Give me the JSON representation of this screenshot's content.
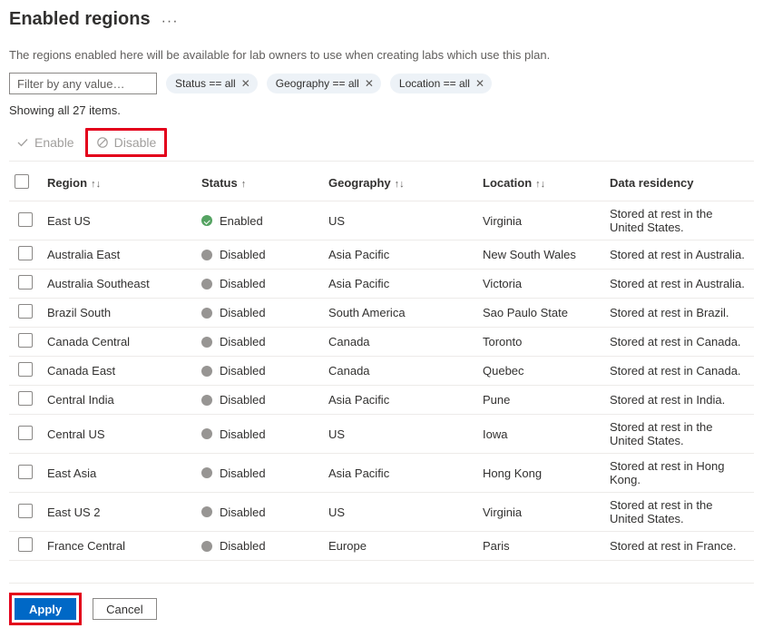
{
  "header": {
    "title": "Enabled regions"
  },
  "description": "The regions enabled here will be available for lab owners to use when creating labs which use this plan.",
  "filter": {
    "placeholder": "Filter by any value…"
  },
  "pills": [
    {
      "label": "Status == all"
    },
    {
      "label": "Geography == all"
    },
    {
      "label": "Location == all"
    }
  ],
  "count": "Showing all 27 items.",
  "toolbar": {
    "enable": "Enable",
    "disable": "Disable"
  },
  "columns": {
    "region": "Region",
    "status": "Status",
    "geography": "Geography",
    "location": "Location",
    "residency": "Data residency"
  },
  "status_labels": {
    "enabled": "Enabled",
    "disabled": "Disabled"
  },
  "rows": [
    {
      "region": "East US",
      "status": "enabled",
      "geography": "US",
      "location": "Virginia",
      "residency": "Stored at rest in the United States."
    },
    {
      "region": "Australia East",
      "status": "disabled",
      "geography": "Asia Pacific",
      "location": "New South Wales",
      "residency": "Stored at rest in Australia."
    },
    {
      "region": "Australia Southeast",
      "status": "disabled",
      "geography": "Asia Pacific",
      "location": "Victoria",
      "residency": "Stored at rest in Australia."
    },
    {
      "region": "Brazil South",
      "status": "disabled",
      "geography": "South America",
      "location": "Sao Paulo State",
      "residency": "Stored at rest in Brazil."
    },
    {
      "region": "Canada Central",
      "status": "disabled",
      "geography": "Canada",
      "location": "Toronto",
      "residency": "Stored at rest in Canada."
    },
    {
      "region": "Canada East",
      "status": "disabled",
      "geography": "Canada",
      "location": "Quebec",
      "residency": "Stored at rest in Canada."
    },
    {
      "region": "Central India",
      "status": "disabled",
      "geography": "Asia Pacific",
      "location": "Pune",
      "residency": "Stored at rest in India."
    },
    {
      "region": "Central US",
      "status": "disabled",
      "geography": "US",
      "location": "Iowa",
      "residency": "Stored at rest in the United States."
    },
    {
      "region": "East Asia",
      "status": "disabled",
      "geography": "Asia Pacific",
      "location": "Hong Kong",
      "residency": "Stored at rest in Hong Kong."
    },
    {
      "region": "East US 2",
      "status": "disabled",
      "geography": "US",
      "location": "Virginia",
      "residency": "Stored at rest in the United States."
    },
    {
      "region": "France Central",
      "status": "disabled",
      "geography": "Europe",
      "location": "Paris",
      "residency": "Stored at rest in France."
    }
  ],
  "footer": {
    "apply": "Apply",
    "cancel": "Cancel"
  }
}
